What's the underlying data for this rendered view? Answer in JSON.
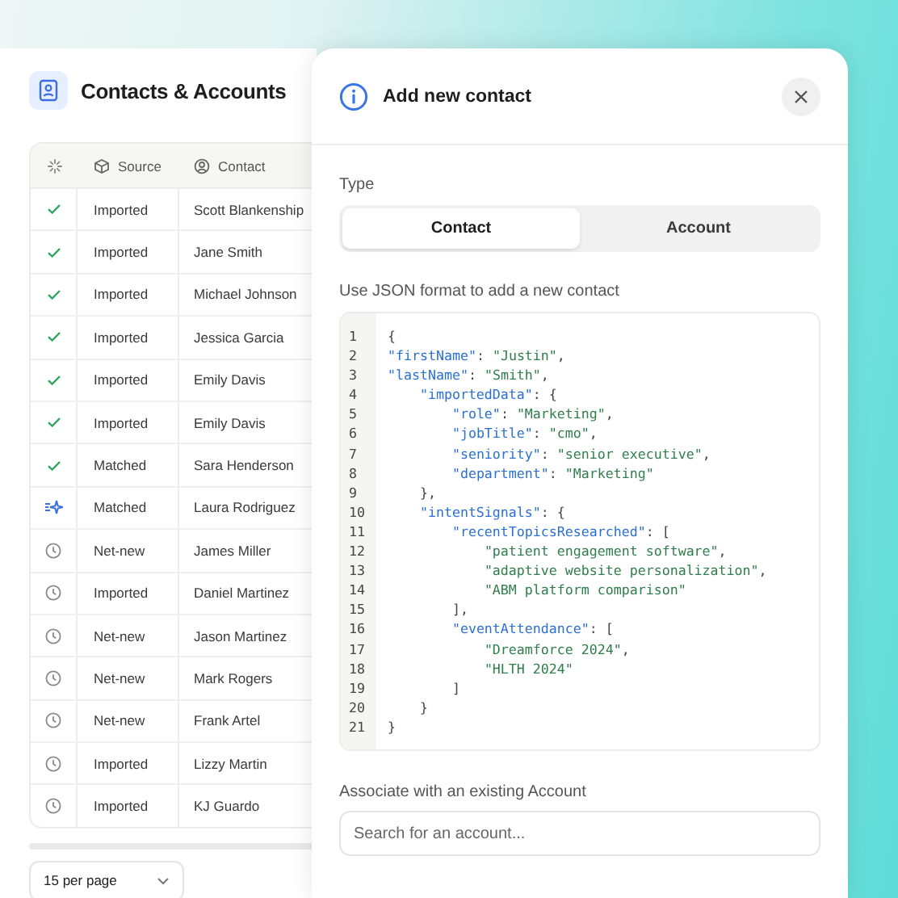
{
  "contacts_panel": {
    "title": "Contacts & Accounts",
    "columns": [
      {
        "kind": "status"
      },
      {
        "kind": "source",
        "label": "Source"
      },
      {
        "kind": "contact",
        "label": "Contact"
      }
    ],
    "rows": [
      {
        "kind": "check",
        "source": "Imported",
        "contact": "Scott Blankenship"
      },
      {
        "kind": "check",
        "source": "Imported",
        "contact": "Jane Smith"
      },
      {
        "kind": "check",
        "source": "Imported",
        "contact": "Michael Johnson"
      },
      {
        "kind": "check",
        "source": "Imported",
        "contact": "Jessica Garcia"
      },
      {
        "kind": "check",
        "source": "Imported",
        "contact": "Emily Davis"
      },
      {
        "kind": "check",
        "source": "Imported",
        "contact": "Emily Davis"
      },
      {
        "kind": "check",
        "source": "Matched",
        "contact": "Sara Henderson"
      },
      {
        "kind": "sparkle",
        "source": "Matched",
        "contact": "Laura Rodriguez"
      },
      {
        "kind": "clock",
        "source": "Net-new",
        "contact": "James Miller"
      },
      {
        "kind": "clock",
        "source": "Imported",
        "contact": "Daniel Martinez"
      },
      {
        "kind": "clock",
        "source": "Net-new",
        "contact": "Jason Martinez"
      },
      {
        "kind": "clock",
        "source": "Net-new",
        "contact": "Mark Rogers"
      },
      {
        "kind": "clock",
        "source": "Net-new",
        "contact": "Frank Artel"
      },
      {
        "kind": "clock",
        "source": "Imported",
        "contact": "Lizzy Martin"
      },
      {
        "kind": "clock",
        "source": "Imported",
        "contact": "KJ Guardo"
      }
    ],
    "page_size": "15 per page"
  },
  "dialog": {
    "title": "Add new contact",
    "type_label": "Type",
    "tabs": [
      {
        "label": "Contact",
        "selected": true
      },
      {
        "label": "Account",
        "selected": false
      }
    ],
    "code_label": "Use JSON format to add a new contact",
    "code_lines": [
      {
        "number": "1",
        "tokens": [
          {
            "kind": "punct",
            "text": "{"
          }
        ]
      },
      {
        "number": "2",
        "tokens": [
          {
            "kind": "key",
            "text": "\"firstName\""
          },
          {
            "kind": "punct",
            "text": ":"
          },
          {
            "kind": "string",
            "text": "\"Justin\""
          },
          {
            "kind": "punct",
            "text": ","
          }
        ]
      },
      {
        "number": "3",
        "tokens": [
          {
            "kind": "key",
            "text": "\"lastName\""
          },
          {
            "kind": "punct",
            "text": ":"
          },
          {
            "kind": "string",
            "text": "\"Smith\""
          },
          {
            "kind": "punct",
            "text": ","
          }
        ],
        "children": [
          {
            "number": "4",
            "tokens": [
              {
                "kind": "key",
                "text": "\"importedData\""
              },
              {
                "kind": "punct",
                "text": ":"
              },
              {
                "kind": "punct",
                "text": "{"
              }
            ],
            "children": [
              {
                "number": "5",
                "tokens": [
                  {
                    "kind": "key",
                    "text": "\"role\""
                  },
                  {
                    "kind": "punct",
                    "text": ":"
                  },
                  {
                    "kind": "string",
                    "text": "\"Marketing\""
                  },
                  {
                    "kind": "punct",
                    "text": ","
                  }
                ]
              },
              {
                "number": "6",
                "tokens": [
                  {
                    "kind": "key",
                    "text": "\"jobTitle\""
                  },
                  {
                    "kind": "punct",
                    "text": ":"
                  },
                  {
                    "kind": "string",
                    "text": "\"cmo\""
                  },
                  {
                    "kind": "punct",
                    "text": ","
                  }
                ]
              },
              {
                "number": "7",
                "tokens": [
                  {
                    "kind": "key",
                    "text": "\"seniority\""
                  },
                  {
                    "kind": "punct",
                    "text": ":"
                  },
                  {
                    "kind": "string",
                    "text": "\"senior executive\""
                  },
                  {
                    "kind": "punct",
                    "text": ","
                  }
                ]
              },
              {
                "number": "8",
                "tokens": [
                  {
                    "kind": "key",
                    "text": "\"department\""
                  },
                  {
                    "kind": "punct",
                    "text": ":"
                  },
                  {
                    "kind": "string",
                    "text": "\"Marketing\""
                  }
                ]
              }
            ]
          },
          {
            "number": "9",
            "tokens": [
              {
                "kind": "punct",
                "text": "},"
              }
            ]
          },
          {
            "number": "10",
            "tokens": [
              {
                "kind": "key",
                "text": "\"intentSignals\""
              },
              {
                "kind": "punct",
                "text": ":"
              },
              {
                "kind": "punct",
                "text": "{"
              }
            ],
            "children": [
              {
                "number": "11",
                "tokens": [
                  {
                    "kind": "key",
                    "text": "\"recentTopicsResearched\""
                  },
                  {
                    "kind": "punct",
                    "text": ":"
                  },
                  {
                    "kind": "punct",
                    "text": "["
                  }
                ],
                "children": [
                  {
                    "number": "12",
                    "tokens": [
                      {
                        "kind": "string",
                        "text": "\"patient engagement software\""
                      },
                      {
                        "kind": "punct",
                        "text": ","
                      }
                    ]
                  },
                  {
                    "number": "13",
                    "tokens": [
                      {
                        "kind": "string",
                        "text": "\"adaptive website personalization\""
                      },
                      {
                        "kind": "punct",
                        "text": ","
                      }
                    ]
                  },
                  {
                    "number": "14",
                    "tokens": [
                      {
                        "kind": "string",
                        "text": "\"ABM platform comparison\""
                      }
                    ]
                  }
                ]
              },
              {
                "number": "15",
                "tokens": [
                  {
                    "kind": "punct",
                    "text": "],"
                  }
                ]
              },
              {
                "number": "16",
                "tokens": [
                  {
                    "kind": "key",
                    "text": "\"eventAttendance\""
                  },
                  {
                    "kind": "punct",
                    "text": ":"
                  },
                  {
                    "kind": "punct",
                    "text": "["
                  }
                ],
                "children": [
                  {
                    "number": "17",
                    "tokens": [
                      {
                        "kind": "string",
                        "text": "\"Dreamforce 2024\""
                      },
                      {
                        "kind": "punct",
                        "text": ","
                      }
                    ]
                  },
                  {
                    "number": "18",
                    "tokens": [
                      {
                        "kind": "string",
                        "text": "\"HLTH 2024\""
                      }
                    ]
                  }
                ]
              },
              {
                "number": "19",
                "tokens": [
                  {
                    "kind": "punct",
                    "text": "]"
                  }
                ]
              }
            ]
          },
          {
            "number": "20",
            "tokens": [
              {
                "kind": "punct",
                "text": "}"
              }
            ]
          }
        ]
      },
      {
        "number": "21",
        "tokens": [
          {
            "kind": "punct",
            "text": "}"
          }
        ]
      }
    ],
    "account_label": "Associate with an existing Account",
    "account_search": {
      "placeholder": "Search for an account..."
    }
  }
}
